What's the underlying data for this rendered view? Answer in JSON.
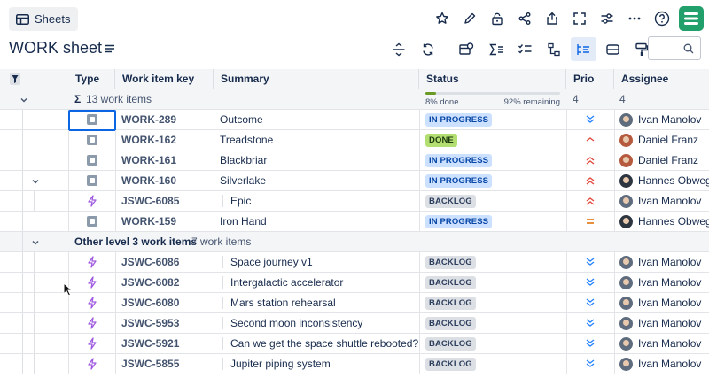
{
  "toolbar": {
    "sheets_label": "Sheets",
    "icons": [
      "star-icon",
      "edit-icon",
      "lock-icon",
      "share-icon",
      "export-icon",
      "fullscreen-icon",
      "settings-sliders-icon",
      "more-icon",
      "help-icon",
      "app-logo"
    ]
  },
  "sheet": {
    "title": "WORK sheet",
    "search_value": ""
  },
  "columns": {
    "type": "Type",
    "key": "Work item key",
    "summary": "Summary",
    "status": "Status",
    "prio": "Prio",
    "assignee": "Assignee"
  },
  "summary_row": {
    "sigma": "Σ",
    "count_label": "13 work items",
    "done_label": "8% done",
    "remaining_label": "92% remaining",
    "progress_fraction": 0.08,
    "prio_count": "4",
    "assignee_count": "4"
  },
  "group2": {
    "label": "Other level 3 work items",
    "count": "7 work items"
  },
  "rows": [
    {
      "key": "WORK-289",
      "summary": "Outcome",
      "status": "IN PROGRESS",
      "prio": "medium-low",
      "assignee": "Ivan Manolov",
      "type": "task"
    },
    {
      "key": "WORK-162",
      "summary": "Treadstone",
      "status": "DONE",
      "prio": "low-up",
      "assignee": "Daniel Franz",
      "type": "task"
    },
    {
      "key": "WORK-161",
      "summary": "Blackbriar",
      "status": "IN PROGRESS",
      "prio": "high",
      "assignee": "Daniel Franz",
      "type": "task"
    },
    {
      "key": "WORK-160",
      "summary": "Silverlake",
      "status": "IN PROGRESS",
      "prio": "high",
      "assignee": "Hannes Obweg",
      "type": "task"
    },
    {
      "key": "JSWC-6085",
      "summary": "Epic",
      "status": "BACKLOG",
      "prio": "high",
      "assignee": "Ivan Manolov",
      "type": "epic"
    },
    {
      "key": "WORK-159",
      "summary": "Iron Hand",
      "status": "IN PROGRESS",
      "prio": "medium",
      "assignee": "Hannes Obweg",
      "type": "task"
    },
    {
      "key": "JSWC-6086",
      "summary": "Space journey v1",
      "status": "BACKLOG",
      "prio": "lowest",
      "assignee": "Ivan Manolov",
      "type": "epic"
    },
    {
      "key": "JSWC-6082",
      "summary": "Intergalactic accelerator",
      "status": "BACKLOG",
      "prio": "lowest",
      "assignee": "Ivan Manolov",
      "type": "epic"
    },
    {
      "key": "JSWC-6080",
      "summary": "Mars station rehearsal",
      "status": "BACKLOG",
      "prio": "lowest",
      "assignee": "Ivan Manolov",
      "type": "epic"
    },
    {
      "key": "JSWC-5953",
      "summary": "Second moon inconsistency",
      "status": "BACKLOG",
      "prio": "lowest",
      "assignee": "Ivan Manolov",
      "type": "epic"
    },
    {
      "key": "JSWC-5921",
      "summary": "Can we get the space shuttle rebooted?",
      "status": "BACKLOG",
      "prio": "lowest",
      "assignee": "Ivan Manolov",
      "type": "epic"
    },
    {
      "key": "JSWC-5855",
      "summary": "Jupiter piping system",
      "status": "BACKLOG",
      "prio": "lowest",
      "assignee": "Ivan Manolov",
      "type": "epic"
    }
  ],
  "colors": {
    "accent": "#0c66e4",
    "logo": "#22a06b",
    "in_progress": "#cce0ff",
    "done": "#b3df72",
    "backlog": "#dcdfe4",
    "prio_high": "#e2483d",
    "prio_medium": "#e06c00",
    "prio_low": "#2684ff"
  }
}
